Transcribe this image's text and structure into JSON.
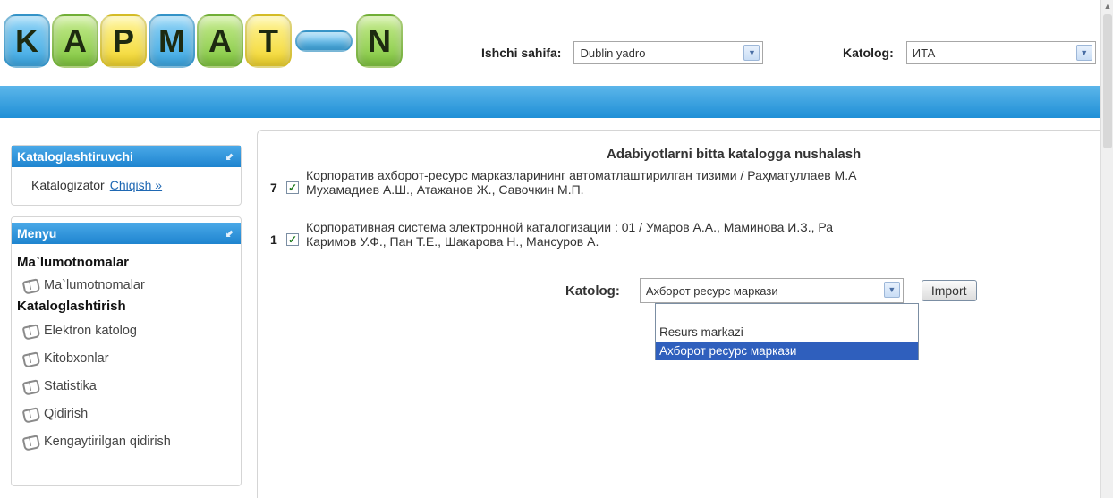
{
  "logo": {
    "letters": [
      "K",
      "A",
      "P",
      "M",
      "A",
      "T",
      "N"
    ]
  },
  "header": {
    "workpage_label": "Ishchi sahifa:",
    "workpage_value": "Dublin yadro",
    "catalog_label": "Katolog:",
    "catalog_value": "ИТА"
  },
  "sidebar": {
    "cataloguer_panel": {
      "title": "Kataloglashtiruvchi",
      "user": "Katalogizator",
      "logout": "Chiqish »"
    },
    "menu_panel": {
      "title": "Menyu",
      "section1": "Ma`lumotnomalar",
      "item1": "Ma`lumotnomalar",
      "section2": "Kataloglashtirish",
      "items": [
        "Elektron katolog",
        "Kitobxonlar",
        "Statistika",
        "Qidirish",
        "Kengaytirilgan qidirish"
      ]
    }
  },
  "main": {
    "title": "Adabiyotlarni bitta katalogga nushalash",
    "records": [
      {
        "num": "7",
        "line1": "Корпоратив ахборот-ресурс марказларининг автоматлаштирилган тизими / Раҳматуллаев М.А",
        "line2": "Мухамадиев А.Ш., Атажанов Ж., Савочкин М.П."
      },
      {
        "num": "1",
        "line1": "Корпоративная система электронной каталогизации : 01 / Умаров А.А., Маминова И.З., Ра",
        "line2": "Каримов У.Ф., Пан Т.Е., Шакарова Н., Мансуров А."
      }
    ],
    "katalog_label": "Katolog:",
    "katalog_value": "Ахборот ресурс маркази",
    "import_label": "Import",
    "dropdown_options": [
      "",
      "Resurs markazi",
      "Ахборот ресурс маркази"
    ]
  },
  "colors": {
    "header_bar": "#1f8fd6",
    "panel_head": "#1e84cf",
    "link": "#1f68b3",
    "dropdown_selected": "#2f5fbd"
  }
}
